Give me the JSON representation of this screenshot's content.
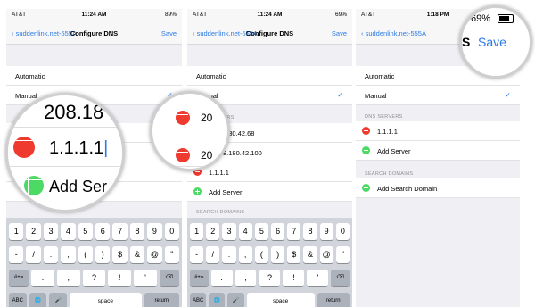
{
  "status": {
    "carrier": "AT&T",
    "times": [
      "11:24 AM",
      "11:24 AM",
      "1:18 PM"
    ],
    "battery": [
      "89%",
      "69%"
    ]
  },
  "nav": {
    "back": "suddenlink.net-555A",
    "title": "Configure DNS",
    "save": "Save"
  },
  "modes": {
    "automatic": "Automatic",
    "manual": "Manual",
    "check": "✓"
  },
  "sections": {
    "dns_servers": "DNS SERVERS",
    "search_domains": "SEARCH DOMAINS"
  },
  "screen1": {
    "dns1": "208.18",
    "dns2": "1.1.1.1",
    "add": "Add Ser"
  },
  "screen2": {
    "dns1_frag": "20",
    "dns1_rest": ".180.42.68",
    "dns2_frag": "20",
    "dns2_rest": "8.180.42.100",
    "dns3": "1.1.1.1",
    "add_server": "Add Server"
  },
  "screen3": {
    "dns1": "1.1.1.1",
    "add_server": "Add Server",
    "add_search_domain": "Add Search Domain",
    "mag_battery": "69%",
    "mag_letter": "S",
    "mag_save": "Save"
  },
  "keyboard": {
    "row1": [
      "1",
      "2",
      "3",
      "4",
      "5",
      "6",
      "7",
      "8",
      "9",
      "0"
    ],
    "row2": [
      "-",
      "/",
      ":",
      ";",
      "(",
      ")",
      "$",
      "&",
      "@",
      "\""
    ],
    "row3_left": "#+=",
    "row3": [
      ".",
      ",",
      "?",
      "!",
      "'"
    ],
    "abc": "ABC",
    "space": "space",
    "return": "return",
    "globe_icon": "globe-icon",
    "mic_icon": "microphone-icon",
    "delete_icon": "backspace-icon"
  },
  "colors": {
    "accent": "#2c7be5",
    "delete": "#ee3a2f",
    "add": "#4cd964"
  }
}
